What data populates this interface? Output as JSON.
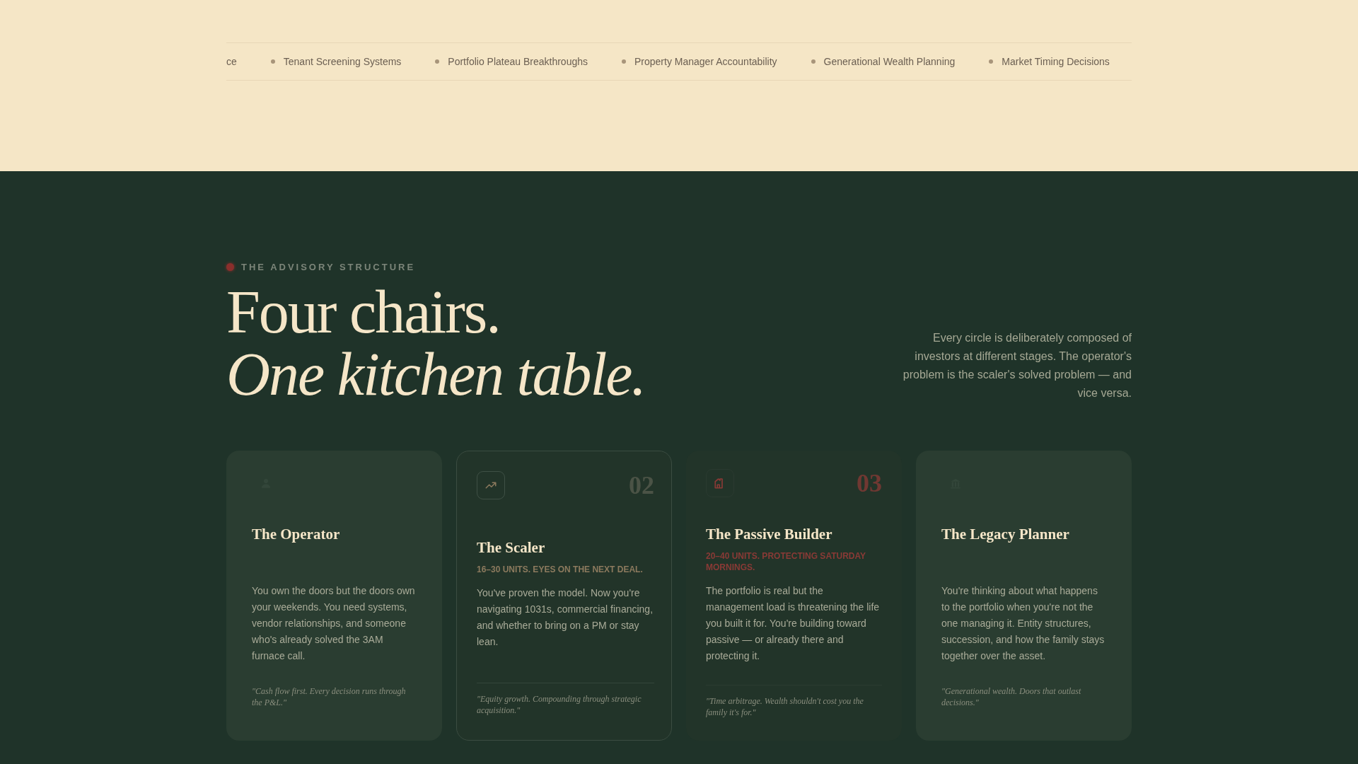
{
  "ticker": [
    "ce",
    "Tenant Screening Systems",
    "Portfolio Plateau Breakthroughs",
    "Property Manager Accountability",
    "Generational Wealth Planning",
    "Market Timing Decisions"
  ],
  "section": {
    "eyebrow": "THE ADVISORY STRUCTURE",
    "title_line_1": "Four chairs.",
    "title_line_2": "One kitchen table.",
    "intro": "Every circle is deliberately composed of investors at different stages. The operator's problem is the scaler's solved problem — and vice versa."
  },
  "cards": [
    {
      "kind": "faded",
      "title": "The Operator",
      "color": "#3a4d40",
      "body": "You own the doors but the doors own your weekends. You need systems, vendor relationships, and someone who's already solved the 3AM furnace call.",
      "quote": "\"Cash flow first. Every decision runs through the P&L.\""
    },
    {
      "kind": "outlined",
      "number": "02",
      "title": "The Scaler",
      "subtitle": "16–30 UNITS. EYES ON THE NEXT DEAL.",
      "color": "#8c7a5e",
      "body": "You've proven the model. Now you're navigating 1031s, commercial financing, and whether to bring on a PM or stay lean.",
      "quote": "\"Equity growth. Compounding through strategic acquisition.\""
    },
    {
      "kind": "plain",
      "number": "03",
      "title": "The Passive Builder",
      "subtitle": "20–40 UNITS. PROTECTING SATURDAY MORNINGS.",
      "color": "#8a3a36",
      "body": "The portfolio is real but the management load is threatening the life you built it for. You're building toward passive — or already there and protecting it.",
      "quote": "\"Time arbitrage. Wealth shouldn't cost you the family it's for.\""
    },
    {
      "kind": "faded",
      "title": "The Legacy Planner",
      "color": "#3a4d40",
      "body": "You're thinking about what happens to the portfolio when you're not the one managing it. Entity structures, succession, and how the family stays together over the asset.",
      "quote": "\"Generational wealth. Doors that outlast decisions.\""
    }
  ]
}
